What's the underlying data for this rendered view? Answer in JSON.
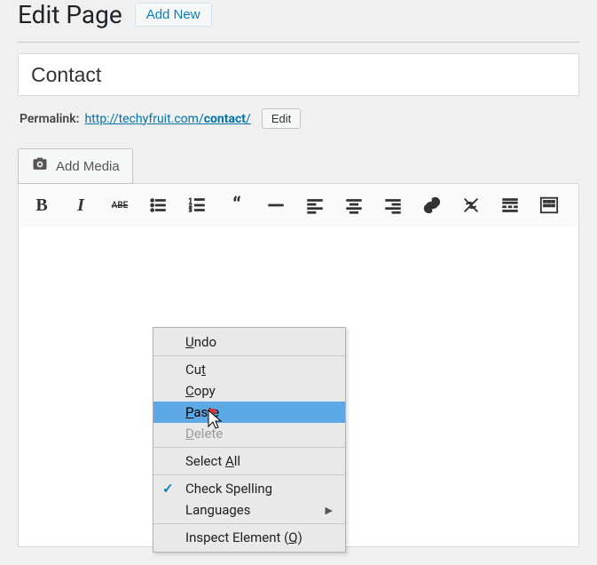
{
  "header": {
    "page_title": "Edit Page",
    "add_new_label": "Add New"
  },
  "title_field": {
    "value": "Contact"
  },
  "permalink": {
    "label": "Permalink:",
    "url_base": "http://techyfruit.com/",
    "url_slug": "contact",
    "url_trail": "/",
    "edit_label": "Edit"
  },
  "media_button": {
    "label": "Add Media"
  },
  "toolbar": {
    "bold": "B",
    "italic": "I",
    "strikethrough": "ABE"
  },
  "context_menu": {
    "undo": "Undo",
    "cut": "Cut",
    "copy": "Copy",
    "paste": "Paste",
    "delete": "Delete",
    "select_all_pre": "Select ",
    "select_all_u": "A",
    "select_all_post": "ll",
    "check_spelling": "Check Spelling",
    "languages": "Languages",
    "inspect_pre": "Inspect Element (",
    "inspect_u": "Q",
    "inspect_post": ")",
    "checked_spell": true,
    "highlighted": "paste"
  }
}
